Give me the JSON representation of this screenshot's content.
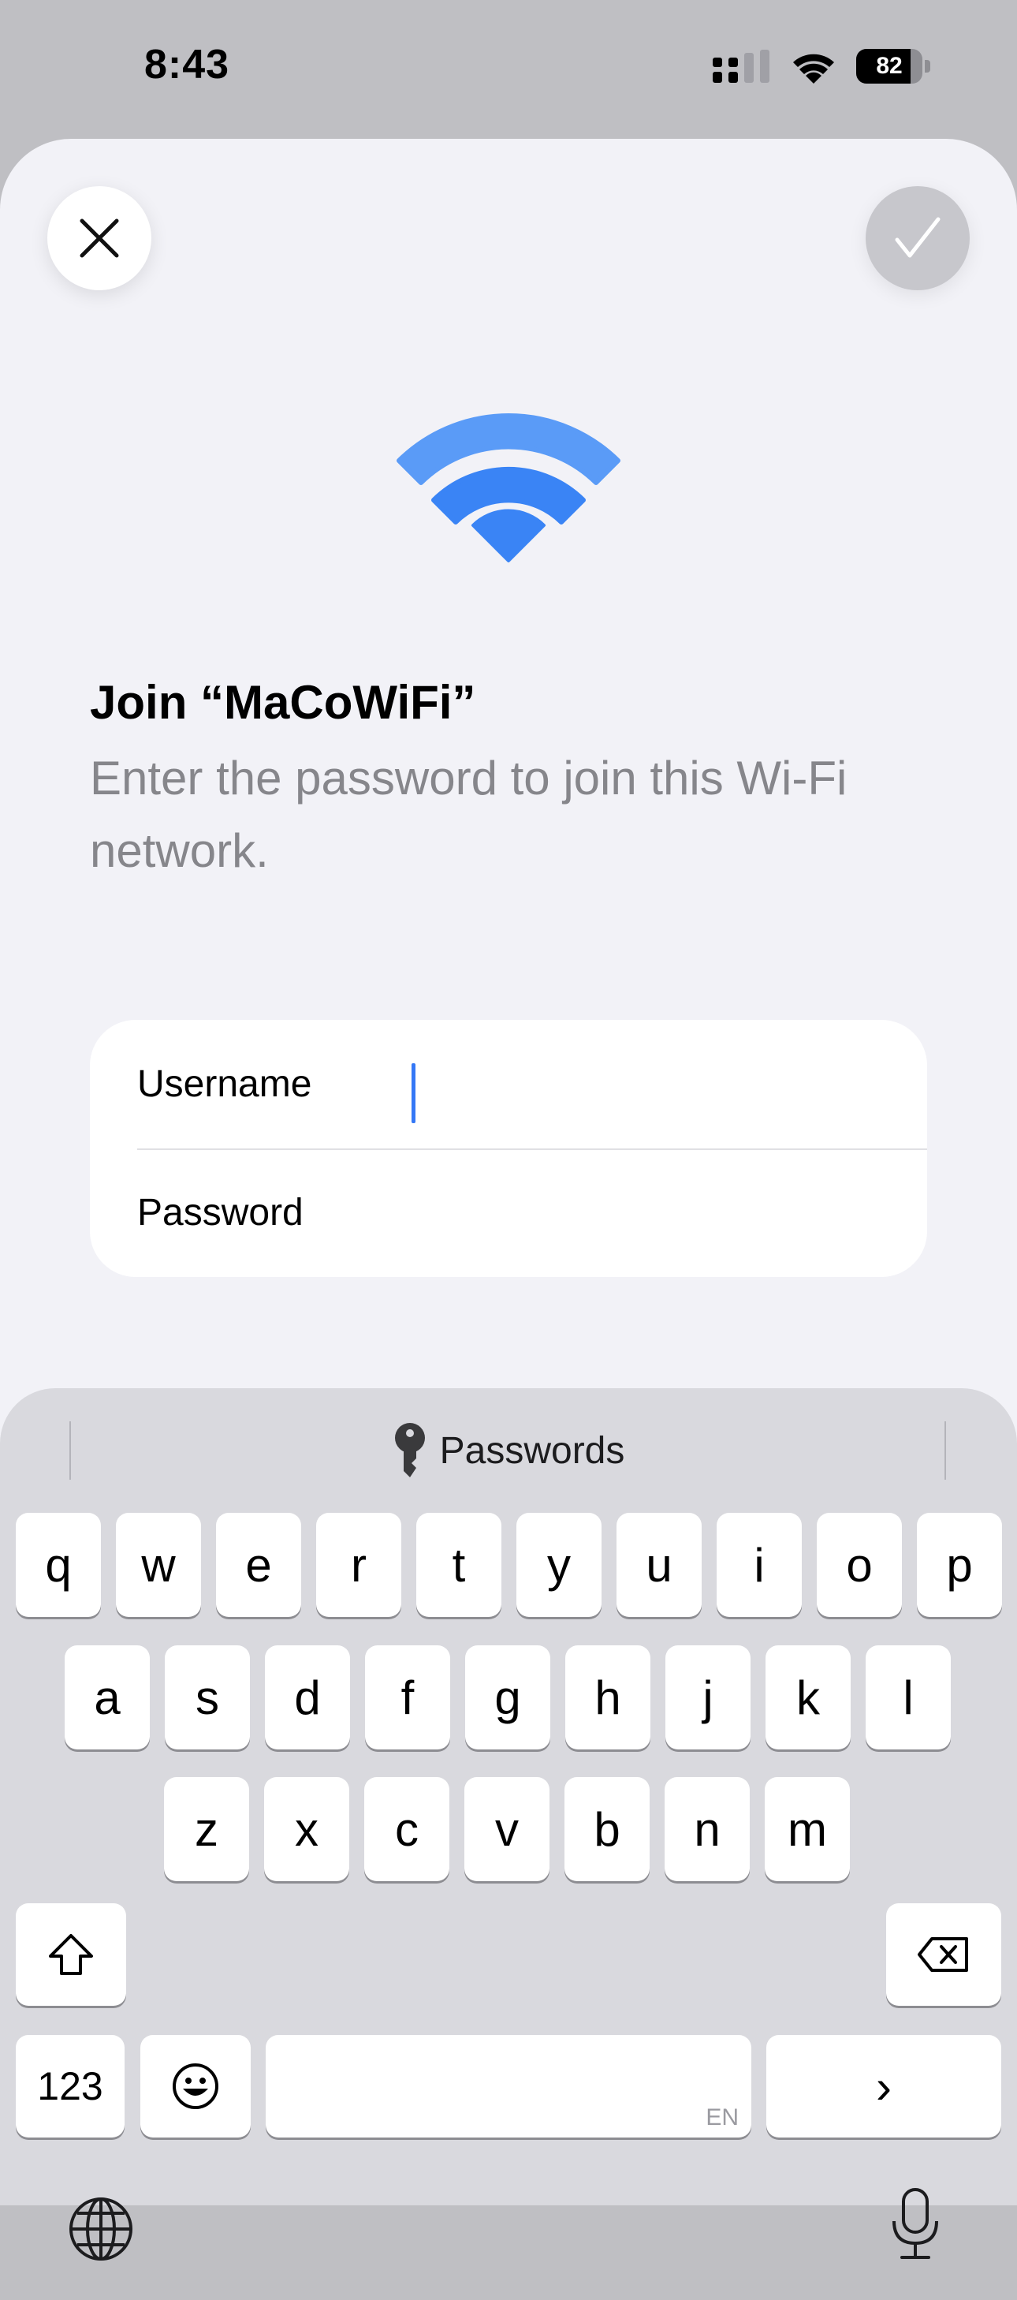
{
  "status_bar": {
    "time": "8:43",
    "battery_level": "82",
    "battery_fraction": 0.82
  },
  "sheet": {
    "title": "Join “MaCoWiFi”",
    "subtitle": "Enter the password to join this Wi-Fi network.",
    "fields": {
      "username_label": "Username",
      "username_value": "",
      "password_label": "Password",
      "password_value": ""
    }
  },
  "keyboard": {
    "suggestion_bar_label": "Passwords",
    "rows": [
      [
        "q",
        "w",
        "e",
        "r",
        "t",
        "y",
        "u",
        "i",
        "o",
        "p"
      ],
      [
        "a",
        "s",
        "d",
        "f",
        "g",
        "h",
        "j",
        "k",
        "l"
      ],
      [
        "z",
        "x",
        "c",
        "v",
        "b",
        "n",
        "m"
      ]
    ],
    "numbers_key": "123",
    "space_language": "EN",
    "return_key_symbol": "›",
    "icons": [
      "close-icon",
      "checkmark-icon",
      "wifi-icon",
      "key-icon",
      "shift-icon",
      "delete-icon",
      "emoji-icon",
      "globe-icon",
      "microphone-icon"
    ]
  },
  "colors": {
    "accent": "#3478f6",
    "wifi_icon": "#3a84f5",
    "sheet_bg": "#f2f2f7",
    "keyboard_bg": "#d9d9de"
  }
}
